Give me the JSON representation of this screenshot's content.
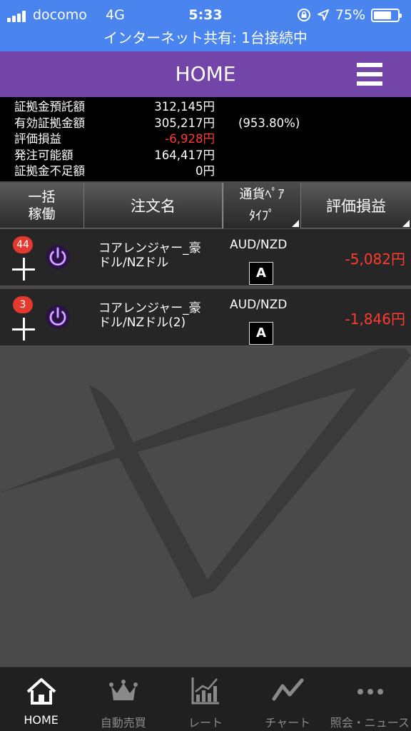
{
  "status_bar": {
    "carrier": "docomo",
    "network": "4G",
    "time": "5:33",
    "battery": "75%",
    "battery_level": 0.75,
    "tethering": "インターネット共有: 1台接続中"
  },
  "header": {
    "title": "HOME"
  },
  "summary": [
    {
      "label": "証拠金預託額",
      "value": "312,145",
      "unit": "円",
      "extra": ""
    },
    {
      "label": "有効証拠金額",
      "value": "305,217",
      "unit": "円",
      "extra": "(953.80%)"
    },
    {
      "label": "評価損益",
      "value": "-6,928",
      "unit": "円",
      "extra": "",
      "negative": true
    },
    {
      "label": "発注可能額",
      "value": "164,417",
      "unit": "円",
      "extra": ""
    },
    {
      "label": "証拠金不足額",
      "value": "0",
      "unit": "円",
      "extra": ""
    }
  ],
  "table_header": {
    "col1_line1": "一括",
    "col1_line2": "稼働",
    "col2": "注文名",
    "col3_line1": "通貨ﾍﾟｱ",
    "col3_line2": "ﾀｲﾌﾟ",
    "col4": "評価損益"
  },
  "orders": [
    {
      "badge": "44",
      "name_line1": "コアレンジャー_豪",
      "name_line2": "ドル/NZドル",
      "pair": "AUD/NZD",
      "type": "A",
      "pnl": "-5,082円"
    },
    {
      "badge": "3",
      "name_line1": "コアレンジャー_豪",
      "name_line2": "ドル/NZドル(2)",
      "pair": "AUD/NZD",
      "type": "A",
      "pnl": "-1,846円"
    }
  ],
  "tabs": [
    {
      "label": "HOME",
      "icon": "home-icon"
    },
    {
      "label": "自動売買",
      "icon": "crown-icon"
    },
    {
      "label": "レート",
      "icon": "rate-chart-icon"
    },
    {
      "label": "チャート",
      "icon": "line-chart-icon"
    },
    {
      "label": "照会・ニュース",
      "icon": "more-icon"
    }
  ],
  "colors": {
    "status_bar": "#4a84ee",
    "header": "#7345a8",
    "negative": "#ff3b2f",
    "badge": "#e23a2f",
    "power": "#a060ff"
  }
}
